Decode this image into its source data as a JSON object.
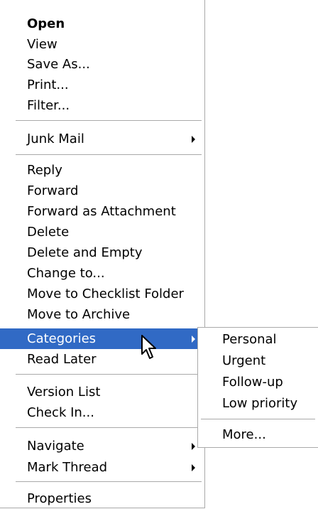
{
  "context_menu": {
    "group1": [
      "Open",
      "View",
      "Save As...",
      "Print...",
      "Filter..."
    ],
    "junk_mail": "Junk Mail",
    "group3": [
      "Reply",
      "Forward",
      "Forward as Attachment",
      "Delete",
      "Delete and Empty",
      "Change to...",
      "Move to Checklist Folder",
      "Move to Archive"
    ],
    "categories": "Categories",
    "read_later": "Read Later",
    "group4": [
      "Version List",
      "Check In..."
    ],
    "navigate": "Navigate",
    "mark_thread": "Mark Thread",
    "properties": "Properties",
    "highlight_color": "#316ac5"
  },
  "categories_submenu": {
    "items": [
      "Personal",
      "Urgent",
      "Follow-up",
      "Low priority"
    ],
    "more": "More..."
  },
  "cursor": {
    "icon": "arrow-pointer-icon"
  }
}
